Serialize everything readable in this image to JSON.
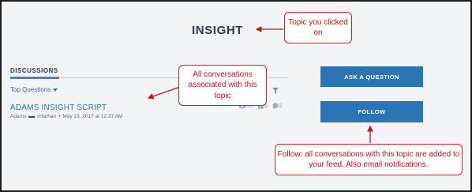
{
  "topic": {
    "title": "INSIGHT"
  },
  "discussions": {
    "header": "DISCUSSIONS",
    "sort_label": "Top Questions",
    "items": [
      {
        "title": "ADAMS INSIGHT SCRIPT",
        "category": "Adams",
        "author": "mfarhan",
        "separator": "•",
        "date": "May 23, 2017 at 12:37 AM",
        "views": "35",
        "likes": "0",
        "comments": "2"
      }
    ]
  },
  "actions": {
    "ask_label": "ASK A QUESTION",
    "follow_label": "FOLLOW"
  },
  "annotations": {
    "topic_callout": "Topic you clicked on",
    "conversations_callout": "All conversations associated with this topic",
    "follow_callout": "Follow: all conversations with this topic are added to your feed. Also email notifications."
  },
  "colors": {
    "accent_blue": "#2c74b3",
    "link_blue": "#2e73b8",
    "callout_red": "#c3141c",
    "panel_bg": "#f2f4f6"
  },
  "icons": {
    "sort": "chevron-down-icon",
    "filter": "filter-icon",
    "views": "eye-icon",
    "likes": "like-icon",
    "comments": "comment-icon"
  }
}
